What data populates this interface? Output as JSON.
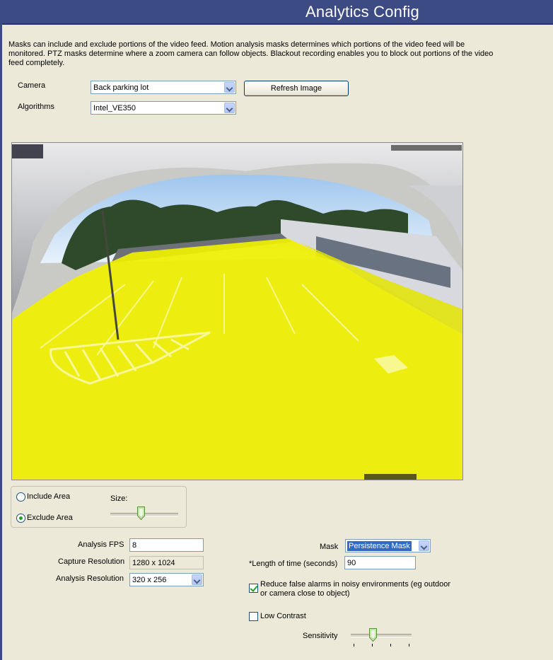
{
  "header": {
    "title": "Analytics Config"
  },
  "description": "Masks can include and exclude portions of the video feed.  Motion analysis masks determines which portions of the video feed will be monitored.  PTZ masks determine where a zoom camera can follow objects.  Blackout recording enables you to block out portions of the video feed completely.",
  "camera": {
    "label": "Camera",
    "value": "Back parking lot"
  },
  "algorithms": {
    "label": "Algorithms",
    "value": "Intel_VE350"
  },
  "refresh_button": {
    "label": "Refresh Image"
  },
  "video": {
    "overlay_color": "#f0f000"
  },
  "area_panel": {
    "include_label": "Include Area",
    "exclude_label": "Exclude Area",
    "include_selected": false,
    "exclude_selected": true,
    "size_label": "Size:",
    "size_level_fraction": 0.3
  },
  "analysis_fps": {
    "label": "Analysis FPS",
    "value": "8"
  },
  "capture_resolution": {
    "label": "Capture Resolution",
    "value": "1280 x 1024"
  },
  "analysis_resolution": {
    "label": "Analysis Resolution",
    "value": "320 x 256"
  },
  "mask": {
    "label": "Mask",
    "value": "Persistence Mask"
  },
  "length_of_time": {
    "label": "*Length of time (seconds)",
    "value": "90"
  },
  "reduce_false_alarms": {
    "line1": "Reduce false alarms in noisy environments (eg outdoor",
    "line2": "or camera close to object)",
    "checked": true
  },
  "low_contrast": {
    "label": "Low Contrast",
    "checked": false
  },
  "sensitivity": {
    "label": "Sensitivity",
    "level_fraction": 0.33
  },
  "colors": {
    "title_bar": "#3c4b83",
    "background": "#ece9d8",
    "selection": "#316ac5"
  }
}
